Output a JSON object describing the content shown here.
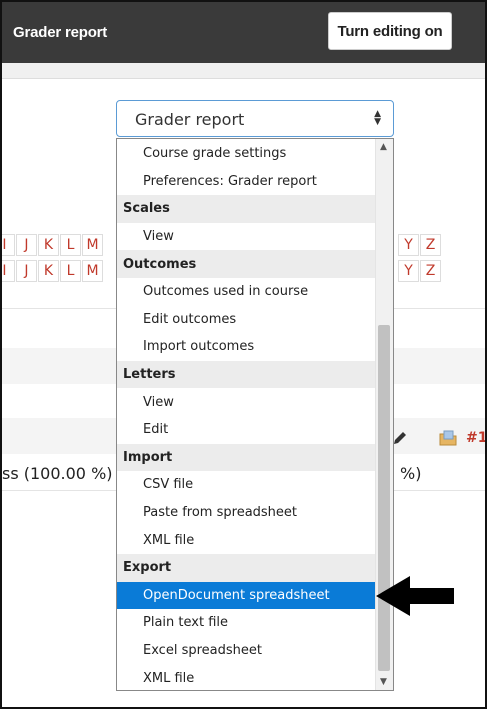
{
  "header": {
    "title": "Grader report",
    "edit_button": "Turn editing on"
  },
  "select": {
    "value": "Grader report"
  },
  "background": {
    "letters_left": [
      "I",
      "J",
      "K",
      "L",
      "M"
    ],
    "letters_right": [
      "Y",
      "Z"
    ],
    "total_text": "ss (100.00 %)",
    "total_text_right": "%)",
    "category_link": "#1"
  },
  "dropdown": {
    "items": [
      {
        "type": "item",
        "label": "Course grade settings"
      },
      {
        "type": "item",
        "label": "Preferences: Grader report"
      },
      {
        "type": "group",
        "label": "Scales"
      },
      {
        "type": "item",
        "label": "View"
      },
      {
        "type": "group",
        "label": "Outcomes"
      },
      {
        "type": "item",
        "label": "Outcomes used in course"
      },
      {
        "type": "item",
        "label": "Edit outcomes"
      },
      {
        "type": "item",
        "label": "Import outcomes"
      },
      {
        "type": "group",
        "label": "Letters"
      },
      {
        "type": "item",
        "label": "View"
      },
      {
        "type": "item",
        "label": "Edit"
      },
      {
        "type": "group",
        "label": "Import"
      },
      {
        "type": "item",
        "label": "CSV file"
      },
      {
        "type": "item",
        "label": "Paste from spreadsheet"
      },
      {
        "type": "item",
        "label": "XML file"
      },
      {
        "type": "group",
        "label": "Export"
      },
      {
        "type": "item",
        "label": "OpenDocument spreadsheet",
        "selected": true
      },
      {
        "type": "item",
        "label": "Plain text file"
      },
      {
        "type": "item",
        "label": "Excel spreadsheet"
      },
      {
        "type": "item",
        "label": "XML file"
      }
    ]
  },
  "colors": {
    "header_bg": "#3a3a3a",
    "selected_bg": "#0a7bd7",
    "link": "#c0392b"
  },
  "icons": {
    "select_caret": "chevron-up-down-icon",
    "pointer": "arrow-left-icon",
    "edit": "pencil-icon",
    "category": "folder-icon"
  }
}
